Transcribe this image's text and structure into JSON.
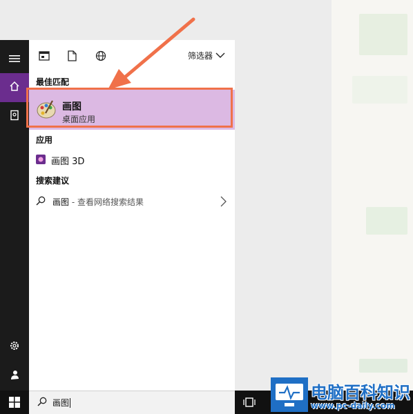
{
  "toolbar": {
    "filter_label": "筛选器"
  },
  "sections": {
    "best_match": "最佳匹配",
    "apps": "应用",
    "suggestions": "搜索建议"
  },
  "best_match": {
    "title": "画图",
    "subtitle": "桌面应用"
  },
  "apps": [
    {
      "label": "画图 3D"
    }
  ],
  "suggestion": {
    "query": "画图",
    "suffix": " - 查看网络搜索结果"
  },
  "search": {
    "value": "画图"
  },
  "watermark": {
    "name": "电脑百科知识",
    "url": "www.pc-daily.com"
  },
  "colors": {
    "accent": "#6b2d8e",
    "highlight": "#dcb9e3",
    "arrow": "#f0714a",
    "watermark": "#1f6fc5"
  },
  "icons": [
    "menu-icon",
    "home-icon",
    "notebook-icon",
    "settings-icon",
    "feedback-icon",
    "windows-icon",
    "app-view-icon",
    "document-icon",
    "globe-icon",
    "chevron-down-icon",
    "paint-icon",
    "paint3d-icon",
    "search-icon",
    "chevron-right-icon",
    "task-view-icon"
  ]
}
